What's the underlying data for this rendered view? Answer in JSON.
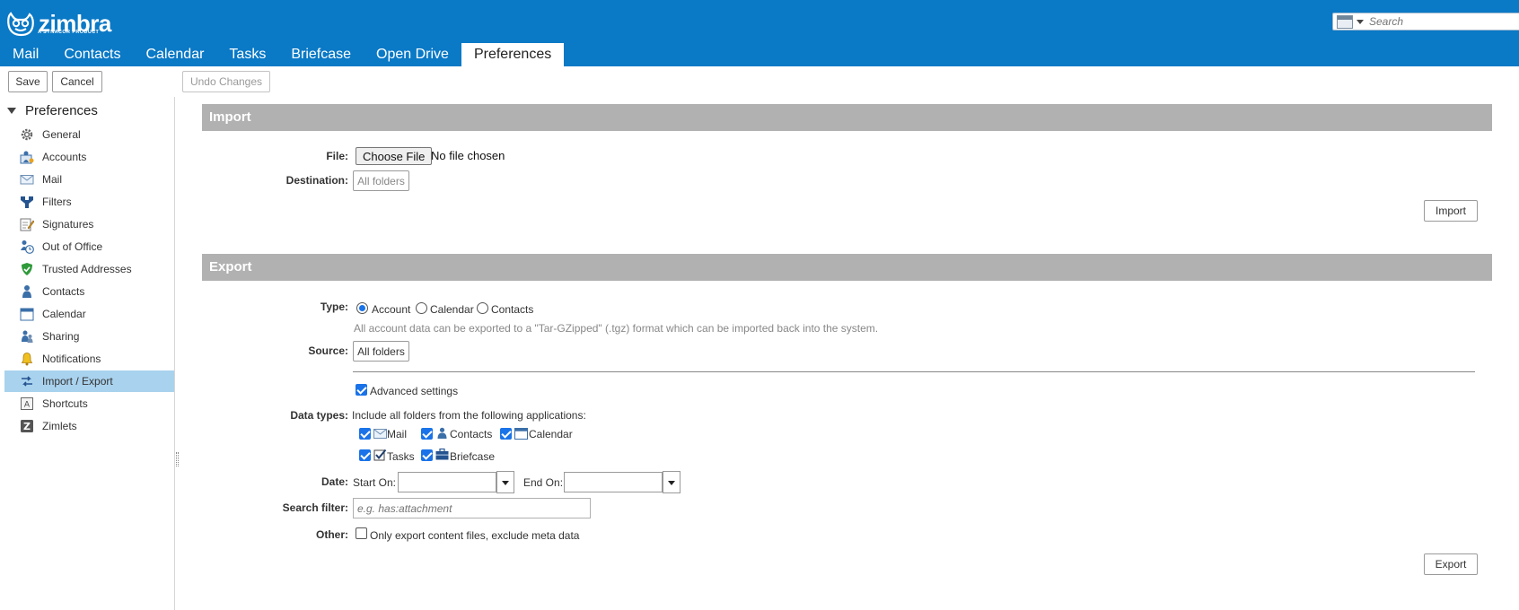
{
  "brand": {
    "name": "zimbra",
    "tagline": "A SYNACOR PRODUCT"
  },
  "search": {
    "placeholder": "Search"
  },
  "app_tabs": [
    "Mail",
    "Contacts",
    "Calendar",
    "Tasks",
    "Briefcase",
    "Open Drive",
    "Preferences"
  ],
  "app_tab_active": "Preferences",
  "toolbar": {
    "save_label": "Save",
    "cancel_label": "Cancel",
    "undo_label": "Undo Changes"
  },
  "sidebar": {
    "header": "Preferences",
    "items": [
      {
        "label": "General",
        "icon": "gear-icon"
      },
      {
        "label": "Accounts",
        "icon": "accounts-icon"
      },
      {
        "label": "Mail",
        "icon": "envelope-icon"
      },
      {
        "label": "Filters",
        "icon": "filter-icon"
      },
      {
        "label": "Signatures",
        "icon": "signature-icon"
      },
      {
        "label": "Out of Office",
        "icon": "out-of-office-icon"
      },
      {
        "label": "Trusted Addresses",
        "icon": "shield-check-icon"
      },
      {
        "label": "Contacts",
        "icon": "contact-person-icon"
      },
      {
        "label": "Calendar",
        "icon": "calendar-icon"
      },
      {
        "label": "Sharing",
        "icon": "sharing-icon"
      },
      {
        "label": "Notifications",
        "icon": "bell-icon"
      },
      {
        "label": "Import / Export",
        "icon": "import-export-icon"
      },
      {
        "label": "Shortcuts",
        "icon": "shortcuts-icon"
      },
      {
        "label": "Zimlets",
        "icon": "zimlet-icon"
      }
    ],
    "selected": "Import / Export"
  },
  "import": {
    "title": "Import",
    "file_label": "File:",
    "choose_file_label": "Choose File",
    "no_file_text": "No file chosen",
    "destination_label": "Destination:",
    "destination_value": "All folders",
    "import_button": "Import"
  },
  "export": {
    "title": "Export",
    "type_label": "Type:",
    "types": [
      {
        "label": "Account",
        "selected": true
      },
      {
        "label": "Calendar",
        "selected": false
      },
      {
        "label": "Contacts",
        "selected": false
      }
    ],
    "type_hint": "All account data can be exported to a \"Tar-GZipped\" (.tgz) format which can be imported back into the system.",
    "source_label": "Source:",
    "source_value": "All folders",
    "advanced_label": "Advanced settings",
    "advanced_checked": true,
    "data_types_label": "Data types:",
    "data_types_intro": "Include all folders from the following applications:",
    "apps": [
      {
        "label": "Mail",
        "checked": true,
        "icon": "envelope-icon"
      },
      {
        "label": "Contacts",
        "checked": true,
        "icon": "contact-person-icon"
      },
      {
        "label": "Calendar",
        "checked": true,
        "icon": "calendar-icon"
      },
      {
        "label": "Tasks",
        "checked": true,
        "icon": "tasks-icon"
      },
      {
        "label": "Briefcase",
        "checked": true,
        "icon": "briefcase-icon"
      }
    ],
    "date_label": "Date:",
    "start_on_label": "Start On:",
    "end_on_label": "End On:",
    "search_filter_label": "Search filter:",
    "search_filter_placeholder": "e.g. has:attachment",
    "other_label": "Other:",
    "other_option": "Only export content files, exclude meta data",
    "other_checked": false,
    "export_button": "Export"
  },
  "colors": {
    "header_bg": "#0a79c6",
    "section_bar": "#b1b1b1",
    "selected_row": "#a9d2ee",
    "checkbox_accent": "#1a73e8"
  }
}
